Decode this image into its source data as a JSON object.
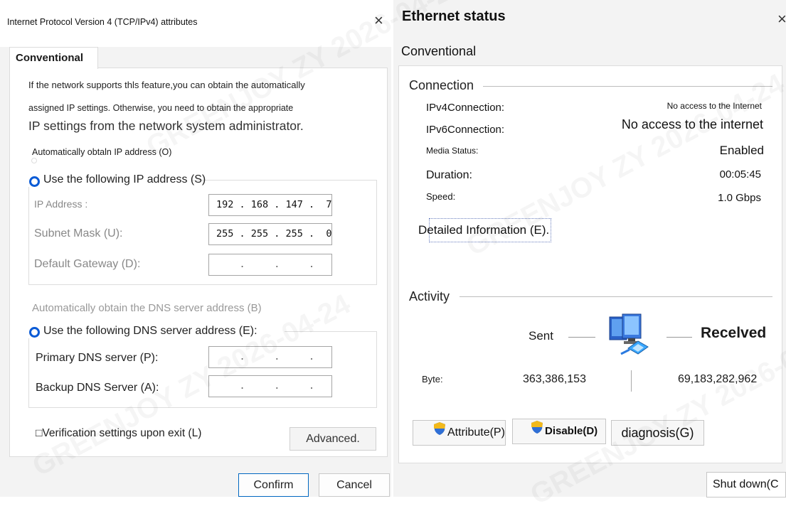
{
  "left": {
    "title": "Internet Protocol Version 4 (TCP/IPv4) attributes",
    "close_glyph": "×",
    "tab": "Conventional",
    "description": {
      "line1": "If the network supports thls feature,you can obtain the automatically",
      "line2": "assigned IP settings. Otherwise, you need to obtain the appropriate",
      "line3": "IP settings from the network system administrator."
    },
    "auto_ip_label": "Automatically obtaln IP address (O)",
    "use_ip_label": "Use the following IP address (S)",
    "ip_address_label": "IP Address :",
    "ip_address_value": "192 . 168 . 147 .  7",
    "subnet_label": "Subnet Mask (U):",
    "subnet_value": "255 . 255 . 255 .  0",
    "gateway_label": "Default Gateway (D):",
    "gateway_value": "    .     .     .",
    "auto_dns_label": "Automatically obtain the DNS server address (B)",
    "use_dns_label": "Use the following DNS server address (E):",
    "primary_dns_label": "Primary DNS server (P):",
    "primary_dns_value": "    .     .     .",
    "backup_dns_label": "Backup DNS Server (A):",
    "backup_dns_value": "    .     .     .",
    "verify_label": "□Verification settings upon exit (L)",
    "advanced_button": "Advanced.",
    "confirm_button": "Confirm",
    "cancel_button": "Cancel"
  },
  "right": {
    "title": "Ethernet status",
    "close_glyph": "×",
    "tab": "Conventional",
    "connection_title": "Connection",
    "ipv4_label": "IPv4Connection:",
    "ipv4_value": "No access to the Internet",
    "ipv6_label": "IPv6Connection:",
    "ipv6_value": "No access to the internet",
    "media_label": "Media Status:",
    "media_value": "Enabled",
    "duration_label": "Duration:",
    "duration_value": "00:05:45",
    "speed_label": "Speed:",
    "speed_value": "1.0 Gbps",
    "details_button": "Detailed Information (E).",
    "activity_title": "Activity",
    "sent_label": "Sent",
    "received_label": "Recelved",
    "byte_label": "Byte:",
    "bytes_sent": "363,386,153",
    "bytes_received": "69,183,282,962",
    "attribute_button": "Attribute(P)",
    "disable_button": "Disable(D)",
    "diagnosis_button": "diagnosis(G)",
    "shutdown_button": "Shut down(C"
  },
  "watermark": "GREENJOY ZY 2026-04-24",
  "colors": {
    "accent": "#0067c0",
    "radio": "#0a5bd6",
    "shield_blue": "#2f6fd6",
    "shield_gold": "#f2b91c"
  },
  "icons": {
    "network": "network-computers-icon",
    "shield": "uac-shield-icon",
    "close": "close-icon"
  }
}
